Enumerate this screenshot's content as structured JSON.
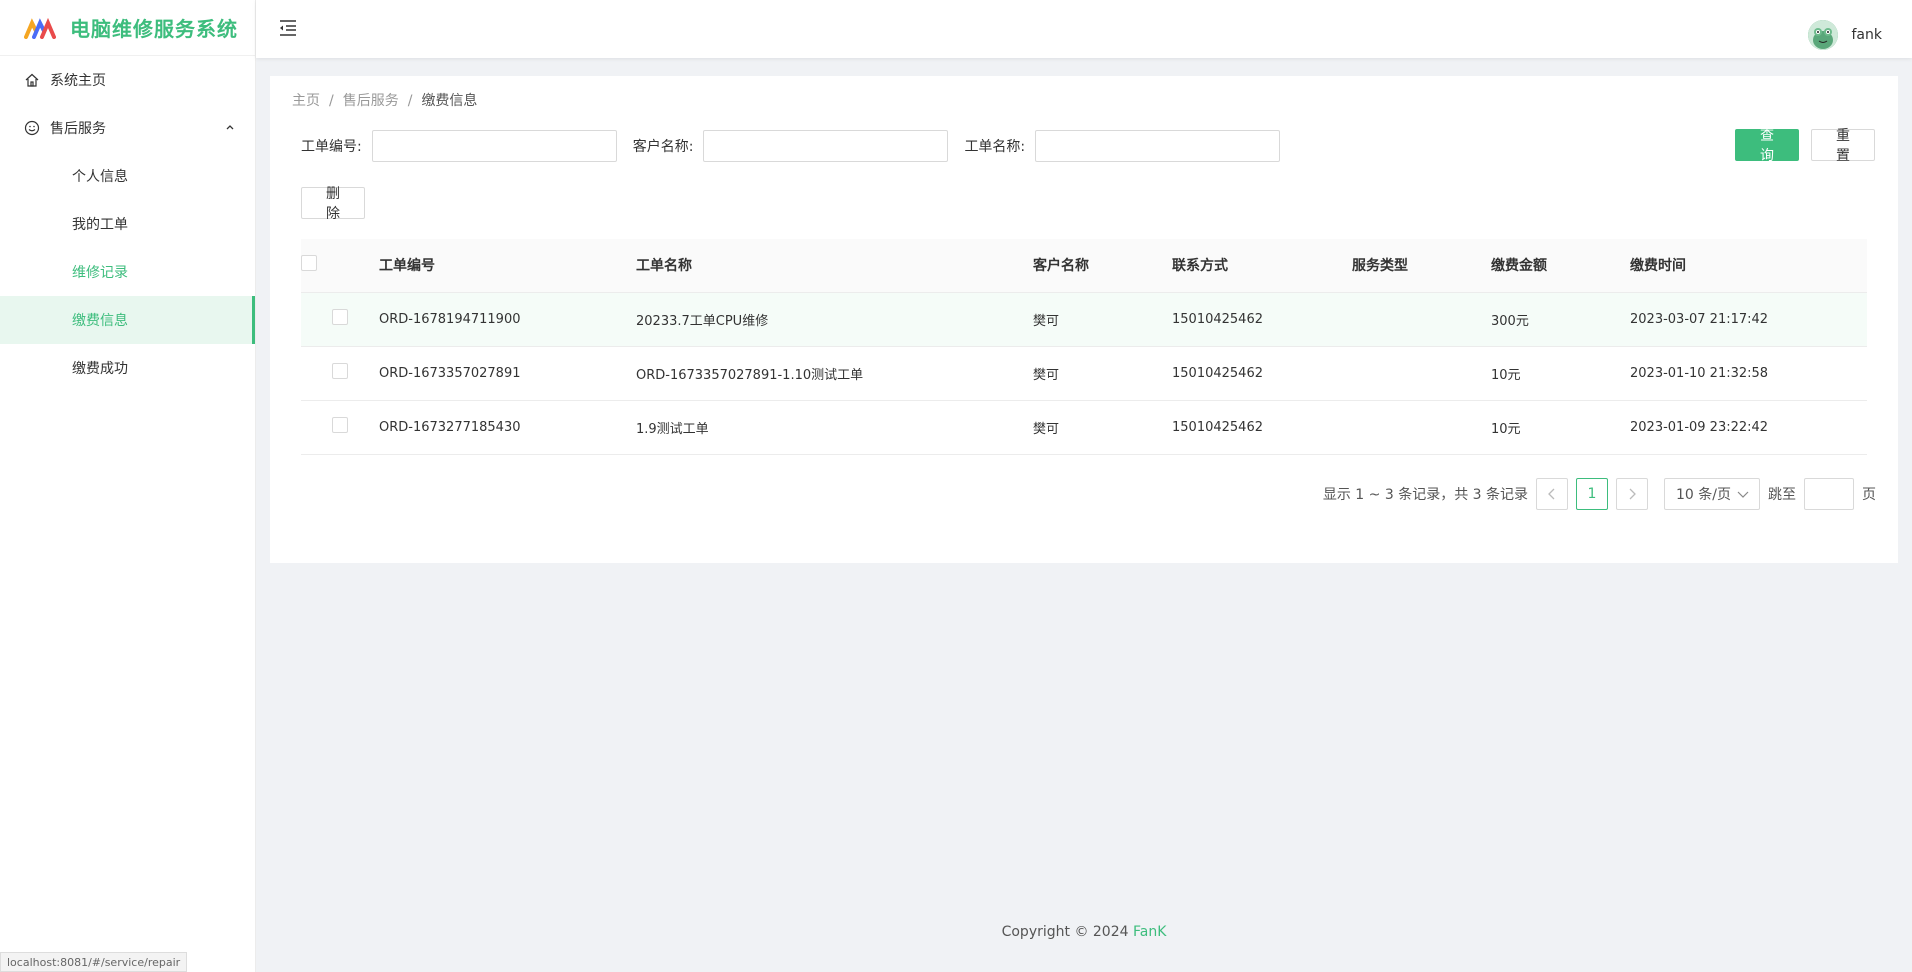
{
  "app": {
    "title": "电脑维修服务系统"
  },
  "sidebar": {
    "items": [
      {
        "label": "系统主页",
        "icon": "home-icon"
      },
      {
        "label": "售后服务",
        "icon": "smile-icon"
      }
    ],
    "subitems": [
      {
        "label": "个人信息"
      },
      {
        "label": "我的工单"
      },
      {
        "label": "维修记录"
      },
      {
        "label": "缴费信息"
      },
      {
        "label": "缴费成功"
      }
    ]
  },
  "header": {
    "username": "fank"
  },
  "breadcrumb": {
    "home": "主页",
    "parent": "售后服务",
    "current": "缴费信息"
  },
  "search": {
    "order_no_label": "工单编号:",
    "customer_label": "客户名称:",
    "order_name_label": "工单名称:",
    "query_label": "查 询",
    "reset_label": "重 置"
  },
  "toolbar": {
    "delete_label": "删 除"
  },
  "table": {
    "headers": [
      "工单编号",
      "工单名称",
      "客户名称",
      "联系方式",
      "服务类型",
      "缴费金额",
      "缴费时间"
    ],
    "rows": [
      {
        "order_no": "ORD-1678194711900",
        "order_name": "20233.7工单CPU维修",
        "customer": "樊可",
        "contact": "15010425462",
        "service_type": "",
        "amount": "300元",
        "time": "2023-03-07 21:17:42"
      },
      {
        "order_no": "ORD-1673357027891",
        "order_name": "ORD-1673357027891-1.10测试工单",
        "customer": "樊可",
        "contact": "15010425462",
        "service_type": "",
        "amount": "10元",
        "time": "2023-01-10 21:32:58"
      },
      {
        "order_no": "ORD-1673277185430",
        "order_name": "1.9测试工单",
        "customer": "樊可",
        "contact": "15010425462",
        "service_type": "",
        "amount": "10元",
        "time": "2023-01-09 23:22:42"
      }
    ]
  },
  "pagination": {
    "total_text": "显示 1 ~ 3 条记录，共 3 条记录",
    "current_page": "1",
    "page_size": "10 条/页",
    "jump_label": "跳至",
    "page_unit": "页"
  },
  "footer": {
    "copyright": "Copyright © 2024",
    "brand": "FanK"
  },
  "status_bar": {
    "url": "localhost:8081/#/service/repair"
  },
  "colors": {
    "accent": "#3dbd7d",
    "background": "#f0f2f5"
  }
}
